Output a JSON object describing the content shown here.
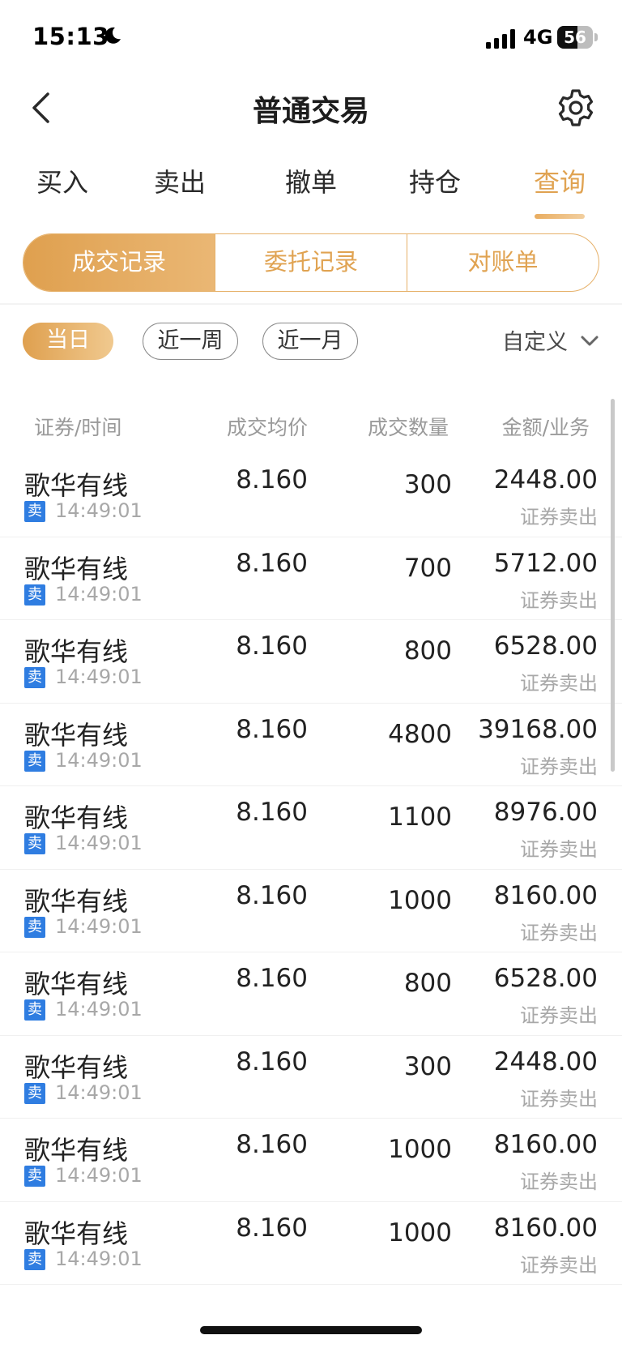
{
  "status_bar": {
    "time": "15:13",
    "network": "4G",
    "battery": "56",
    "battery_level": 0.56
  },
  "header": {
    "title": "普通交易"
  },
  "main_tabs": [
    {
      "label": "买入",
      "active": false
    },
    {
      "label": "卖出",
      "active": false
    },
    {
      "label": "撤单",
      "active": false
    },
    {
      "label": "持仓",
      "active": false
    },
    {
      "label": "查询",
      "active": true
    }
  ],
  "sub_tabs": [
    {
      "label": "成交记录",
      "active": true
    },
    {
      "label": "委托记录",
      "active": false
    },
    {
      "label": "对账单",
      "active": false
    }
  ],
  "filters": {
    "chips": [
      {
        "label": "当日",
        "active": true
      },
      {
        "label": "近一周",
        "active": false
      },
      {
        "label": "近一月",
        "active": false
      }
    ],
    "custom_label": "自定义"
  },
  "table": {
    "columns": [
      "证券/时间",
      "成交均价",
      "成交数量",
      "金额/业务"
    ],
    "rows": [
      {
        "name": "歌华有线",
        "badge": "卖",
        "time": "14:49:01",
        "price": "8.160",
        "qty": "300",
        "amount": "2448.00",
        "biz": "证券卖出"
      },
      {
        "name": "歌华有线",
        "badge": "卖",
        "time": "14:49:01",
        "price": "8.160",
        "qty": "700",
        "amount": "5712.00",
        "biz": "证券卖出"
      },
      {
        "name": "歌华有线",
        "badge": "卖",
        "time": "14:49:01",
        "price": "8.160",
        "qty": "800",
        "amount": "6528.00",
        "biz": "证券卖出"
      },
      {
        "name": "歌华有线",
        "badge": "卖",
        "time": "14:49:01",
        "price": "8.160",
        "qty": "4800",
        "amount": "39168.00",
        "biz": "证券卖出"
      },
      {
        "name": "歌华有线",
        "badge": "卖",
        "time": "14:49:01",
        "price": "8.160",
        "qty": "1100",
        "amount": "8976.00",
        "biz": "证券卖出"
      },
      {
        "name": "歌华有线",
        "badge": "卖",
        "time": "14:49:01",
        "price": "8.160",
        "qty": "1000",
        "amount": "8160.00",
        "biz": "证券卖出"
      },
      {
        "name": "歌华有线",
        "badge": "卖",
        "time": "14:49:01",
        "price": "8.160",
        "qty": "800",
        "amount": "6528.00",
        "biz": "证券卖出"
      },
      {
        "name": "歌华有线",
        "badge": "卖",
        "time": "14:49:01",
        "price": "8.160",
        "qty": "300",
        "amount": "2448.00",
        "biz": "证券卖出"
      },
      {
        "name": "歌华有线",
        "badge": "卖",
        "time": "14:49:01",
        "price": "8.160",
        "qty": "1000",
        "amount": "8160.00",
        "biz": "证券卖出"
      },
      {
        "name": "歌华有线",
        "badge": "卖",
        "time": "14:49:01",
        "price": "8.160",
        "qty": "1000",
        "amount": "8160.00",
        "biz": "证券卖出"
      }
    ]
  },
  "colors": {
    "accent": "#e0a352",
    "sell_badge": "#2f7de1"
  },
  "icons": {
    "back": "chevron-left-icon",
    "settings": "gear-icon",
    "moon": "moon-icon",
    "signal": "signal-icon",
    "battery": "battery-icon",
    "dropdown": "chevron-down-icon"
  }
}
